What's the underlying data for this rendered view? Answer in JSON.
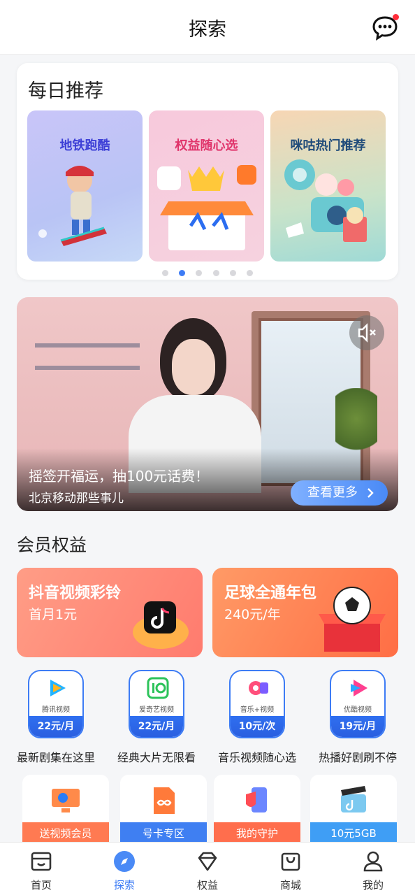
{
  "header": {
    "title": "探索",
    "message_icon": "chat-bubble-icon",
    "has_badge": true
  },
  "daily": {
    "title": "每日推荐",
    "cards": [
      {
        "label": "地铁跑酷"
      },
      {
        "label": "权益随心选"
      },
      {
        "label": "咪咕热门推荐"
      }
    ],
    "dots": 6,
    "active_dot": 1
  },
  "video": {
    "caption": "摇签开福运，抽100元话费！",
    "subtitle": "北京移动那些事儿",
    "more_label": "查看更多",
    "mute_icon": "speaker-mute-icon"
  },
  "members": {
    "title": "会员权益",
    "promos": [
      {
        "title": "抖音视频彩铃",
        "sub": "首月1元"
      },
      {
        "title": "足球全通年包",
        "sub": "240元/年"
      }
    ],
    "apps": [
      {
        "name": "腾讯视频",
        "price": "22元/月",
        "caption": "最新剧集在这里",
        "color": "#23b3ff"
      },
      {
        "name": "爱奇艺视频",
        "price": "22元/月",
        "caption": "经典大片无限看",
        "color": "#2cc35a"
      },
      {
        "name": "音乐+视频",
        "price": "10元/次",
        "caption": "音乐视频随心选",
        "color": "#ff4f7b"
      },
      {
        "name": "优酷视频",
        "price": "19元/月",
        "caption": "热播好剧刷不停",
        "color": "#ff3f8f"
      }
    ],
    "tiles": [
      {
        "label": "送视频会员"
      },
      {
        "label": "号卡专区"
      },
      {
        "label": "我的守护"
      },
      {
        "label": "10元5GB"
      }
    ]
  },
  "tabbar": {
    "items": [
      {
        "label": "首页",
        "icon": "home-icon"
      },
      {
        "label": "探索",
        "icon": "compass-icon",
        "active": true
      },
      {
        "label": "权益",
        "icon": "diamond-icon"
      },
      {
        "label": "商城",
        "icon": "shopping-bag-icon"
      },
      {
        "label": "我的",
        "icon": "profile-icon"
      }
    ]
  }
}
